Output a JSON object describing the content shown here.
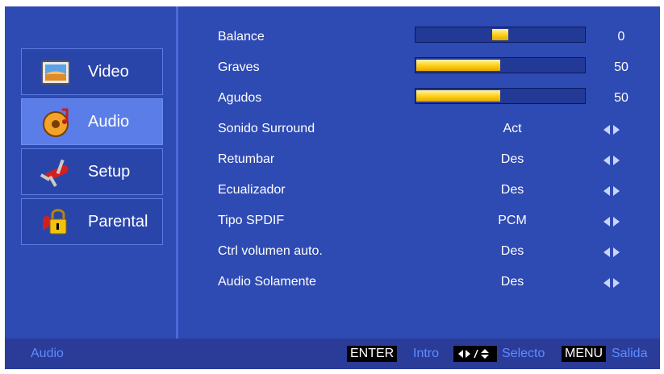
{
  "sidebar": {
    "items": [
      {
        "label": "Video",
        "icon": "video-icon"
      },
      {
        "label": "Audio",
        "icon": "audio-icon",
        "active": true
      },
      {
        "label": "Setup",
        "icon": "setup-icon"
      },
      {
        "label": "Parental",
        "icon": "parental-lock-icon"
      }
    ]
  },
  "settings": [
    {
      "label": "Balance",
      "type": "bar",
      "value": "0",
      "level": 0
    },
    {
      "label": "Graves",
      "type": "bar",
      "value": "50",
      "level": 50
    },
    {
      "label": "Agudos",
      "type": "bar",
      "value": "50",
      "level": 50
    },
    {
      "label": "Sonido Surround",
      "type": "option",
      "value": "Act"
    },
    {
      "label": "Retumbar",
      "type": "option",
      "value": "Des"
    },
    {
      "label": "Ecualizador",
      "type": "option",
      "value": "Des"
    },
    {
      "label": "Tipo SPDIF",
      "type": "option",
      "value": "PCM"
    },
    {
      "label": "Ctrl volumen auto.",
      "type": "option",
      "value": "Des"
    },
    {
      "label": "Audio Solamente",
      "type": "option",
      "value": "Des"
    }
  ],
  "footer": {
    "title": "Audio",
    "enter_key": "ENTER",
    "enter_label": "Intro",
    "select_key": "◆/◆",
    "select_label": "Selecto",
    "menu_key": "MENU",
    "menu_label": "Salida"
  },
  "colors": {
    "background": "#2e4ab3",
    "active_item": "#5b7de8",
    "bar_fill": "#ffd21a",
    "footer_text": "#5f8cff"
  }
}
